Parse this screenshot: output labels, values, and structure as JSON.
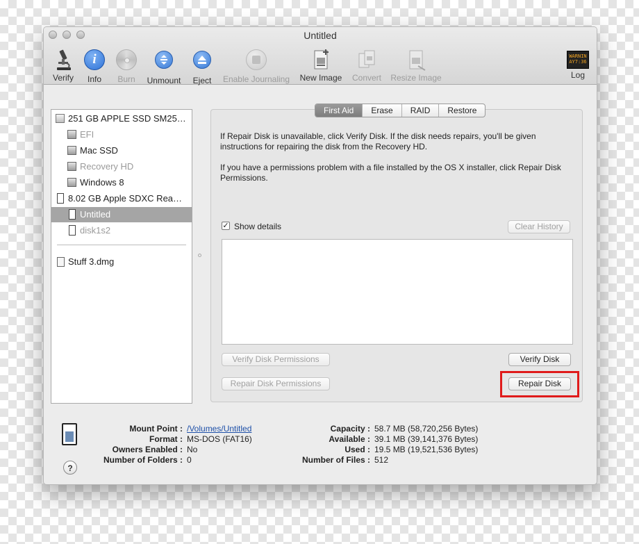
{
  "window": {
    "title": "Untitled"
  },
  "toolbar": [
    {
      "label": "Verify",
      "icon": "microscope-icon",
      "enabled": true
    },
    {
      "label": "Info",
      "icon": "info-icon",
      "enabled": true
    },
    {
      "label": "Burn",
      "icon": "burn-disc-icon",
      "enabled": false
    },
    {
      "label": "Unmount",
      "icon": "unmount-icon",
      "enabled": true
    },
    {
      "label": "Eject",
      "icon": "eject-icon",
      "enabled": true
    },
    {
      "label": "Enable Journaling",
      "icon": "journaling-icon",
      "enabled": false
    },
    {
      "label": "New Image",
      "icon": "new-image-icon",
      "enabled": true
    },
    {
      "label": "Convert",
      "icon": "convert-icon",
      "enabled": false
    },
    {
      "label": "Resize Image",
      "icon": "resize-image-icon",
      "enabled": false
    },
    {
      "label": "Log",
      "icon": "log-icon",
      "enabled": true
    }
  ],
  "log_icon_text": [
    "WARNIN",
    "AY7:36"
  ],
  "sidebar": {
    "items": [
      {
        "label": "251 GB APPLE SSD SM25…",
        "type": "drive",
        "level": 0,
        "dimmed": false,
        "selected": false
      },
      {
        "label": "EFI",
        "type": "volume",
        "level": 1,
        "dimmed": true,
        "selected": false
      },
      {
        "label": "Mac SSD",
        "type": "volume",
        "level": 1,
        "dimmed": false,
        "selected": false
      },
      {
        "label": "Recovery HD",
        "type": "volume",
        "level": 1,
        "dimmed": true,
        "selected": false
      },
      {
        "label": "Windows 8",
        "type": "volume",
        "level": 1,
        "dimmed": false,
        "selected": false
      },
      {
        "label": "8.02 GB Apple SDXC Rea…",
        "type": "card",
        "level": 0,
        "dimmed": false,
        "selected": false
      },
      {
        "label": "Untitled",
        "type": "card",
        "level": 1,
        "dimmed": false,
        "selected": true
      },
      {
        "label": "disk1s2",
        "type": "card",
        "level": 1,
        "dimmed": true,
        "selected": false
      }
    ],
    "images": [
      {
        "label": "Stuff 3.dmg",
        "type": "image"
      }
    ]
  },
  "tabs": [
    {
      "label": "First Aid",
      "active": true
    },
    {
      "label": "Erase",
      "active": false
    },
    {
      "label": "RAID",
      "active": false
    },
    {
      "label": "Restore",
      "active": false
    }
  ],
  "first_aid": {
    "message1": "If Repair Disk is unavailable, click Verify Disk. If the disk needs repairs, you'll be given instructions for repairing the disk from the Recovery HD.",
    "message2": "If you have a permissions problem with a file installed by the OS X installer, click Repair Disk Permissions.",
    "show_details_label": "Show details",
    "show_details_checked": true,
    "clear_history_label": "Clear History",
    "verify_permissions_label": "Verify Disk Permissions",
    "repair_permissions_label": "Repair Disk Permissions",
    "verify_disk_label": "Verify Disk",
    "repair_disk_label": "Repair Disk"
  },
  "info": {
    "mount_point_label": "Mount Point :",
    "mount_point_value": "/Volumes/Untitled",
    "format_label": "Format :",
    "format_value": "MS-DOS (FAT16)",
    "owners_label": "Owners Enabled :",
    "owners_value": "No",
    "folders_label": "Number of Folders :",
    "folders_value": "0",
    "capacity_label": "Capacity :",
    "capacity_value": "58.7 MB (58,720,256 Bytes)",
    "available_label": "Available :",
    "available_value": "39.1 MB (39,141,376 Bytes)",
    "used_label": "Used :",
    "used_value": "19.5 MB (19,521,536 Bytes)",
    "files_label": "Number of Files :",
    "files_value": "512"
  },
  "help_label": "?",
  "colors": {
    "highlight": "#e01b1b",
    "selection": "#a5a5a5",
    "info_blue": "#2f73d8",
    "link": "#1d4fa8"
  }
}
